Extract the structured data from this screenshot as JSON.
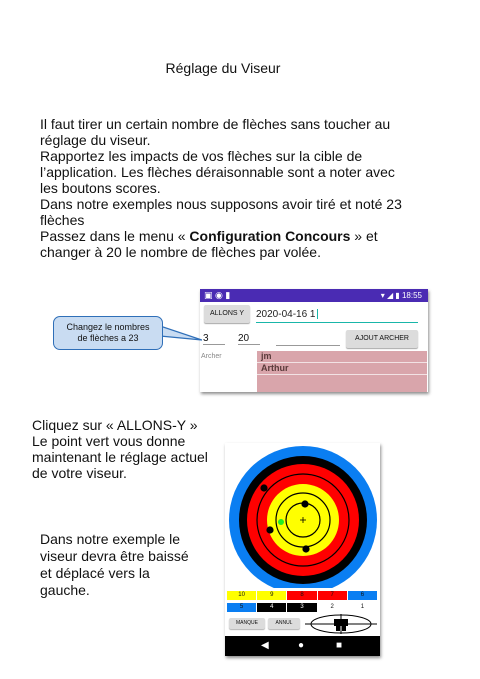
{
  "title": "Réglage du Viseur",
  "intro": {
    "l1": "Il faut tirer un certain nombre de flèches sans toucher au",
    "l2": "réglage du viseur.",
    "l3": "Rapportez les impacts de vos flèches sur la cible de",
    "l4": "l’application. Les flèches déraisonnable sont a noter avec",
    "l5": "les boutons scores.",
    "l6": "Dans notre exemples nous supposons avoir tiré et noté 23",
    "l7": "flèches",
    "l8_pre": "Passez dans le menu « ",
    "l8_bold": "Configuration Concours",
    "l8_post": " » et",
    "l9": "changer à 20 le nombre de flèches par volée."
  },
  "callout": {
    "line1": "Changez le nombres",
    "line2": "de flèches a 23"
  },
  "screen1": {
    "status_icons": "▣ ◉ ▮",
    "status_time": "18:55",
    "allons_button": "ALLONS Y",
    "date_value": "2020-04-16 1",
    "field_a": "3",
    "field_b": "20",
    "ajout_button": "AJOUT ARCHER",
    "archer_label": "Archer",
    "archers": [
      "jm",
      "Arthur"
    ]
  },
  "section2": {
    "l1": "Cliquez sur « ALLONS-Y »",
    "l2": "Le point vert vous donne",
    "l3": "maintenant le réglage actuel",
    "l4": "de votre viseur."
  },
  "section3": {
    "l1": "Dans notre exemple le",
    "l2": "viseur devra être baissé",
    "l3": "et déplacé vers la",
    "l4": "gauche."
  },
  "screen2": {
    "scores_row1": [
      "10",
      "9",
      "8",
      "7",
      "6"
    ],
    "scores_row2": [
      "5",
      "4",
      "3",
      "2",
      "1"
    ],
    "manque_button": "MANQUE",
    "annul_button": "ANNUL",
    "colors": {
      "yellow": "#ffff00",
      "red": "#ff0000",
      "blue": "#0a7ef2",
      "black": "#000000",
      "white": "#ffffff",
      "green_dot": "#22ee22"
    }
  }
}
